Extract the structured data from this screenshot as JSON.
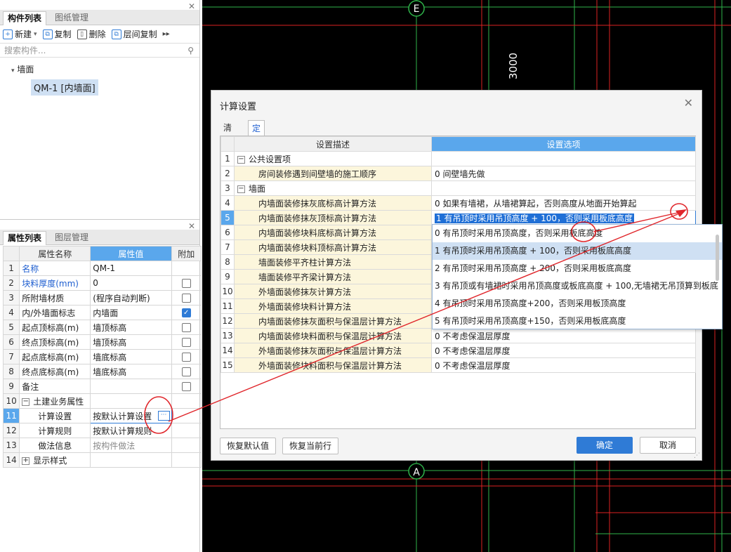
{
  "component_panel": {
    "tabs": [
      "构件列表",
      "图纸管理"
    ],
    "toolbar": {
      "new": "新建",
      "copy": "复制",
      "delete": "删除",
      "floor_copy": "层间复制"
    },
    "search_placeholder": "搜索构件...",
    "tree_group": "墙面",
    "tree_item": "QM-1 [内墙面]"
  },
  "property_panel": {
    "tabs": [
      "属性列表",
      "图层管理"
    ],
    "headers": {
      "name": "属性名称",
      "value": "属性值",
      "extra": "附加"
    },
    "rows": [
      {
        "n": "1",
        "name": "名称",
        "value": "QM-1",
        "checkbox": "none",
        "blue": true
      },
      {
        "n": "2",
        "name": "块料厚度(mm)",
        "value": "0",
        "checkbox": "off",
        "blue": true
      },
      {
        "n": "3",
        "name": "所附墙材质",
        "value": "(程序自动判断)",
        "checkbox": "off",
        "blue": false
      },
      {
        "n": "4",
        "name": "内/外墙面标志",
        "value": "内墙面",
        "checkbox": "on",
        "blue": false
      },
      {
        "n": "5",
        "name": "起点顶标高(m)",
        "value": "墙顶标高",
        "checkbox": "off",
        "blue": false
      },
      {
        "n": "6",
        "name": "终点顶标高(m)",
        "value": "墙顶标高",
        "checkbox": "off",
        "blue": false
      },
      {
        "n": "7",
        "name": "起点底标高(m)",
        "value": "墙底标高",
        "checkbox": "off",
        "blue": false
      },
      {
        "n": "8",
        "name": "终点底标高(m)",
        "value": "墙底标高",
        "checkbox": "off",
        "blue": false
      },
      {
        "n": "9",
        "name": "备注",
        "value": "",
        "checkbox": "off",
        "blue": false
      },
      {
        "n": "10",
        "name": "土建业务属性",
        "value": "",
        "checkbox": "none",
        "blue": false
      },
      {
        "n": "11",
        "name": "计算设置",
        "value": "按默认计算设置",
        "checkbox": "none",
        "blue": false
      },
      {
        "n": "12",
        "name": "计算规则",
        "value": "按默认计算规则",
        "checkbox": "none",
        "blue": false
      },
      {
        "n": "13",
        "name": "做法信息",
        "value": "按构件做法",
        "checkbox": "none",
        "blue": false
      },
      {
        "n": "14",
        "name": "显示样式",
        "value": "",
        "checkbox": "none",
        "blue": false
      }
    ],
    "ellipsis": "···"
  },
  "cad": {
    "axis_top": "E",
    "axis_bottom": "A",
    "dimension": "3000"
  },
  "dialog": {
    "title": "计算设置",
    "tabs": [
      "清单",
      "定额"
    ],
    "col_desc": "设置描述",
    "col_opt": "设置选项",
    "rows": [
      {
        "n": "1",
        "desc": "公共设置项",
        "opt": "",
        "group": true
      },
      {
        "n": "2",
        "desc": "房间装修遇到间壁墙的施工顺序",
        "opt": "0 间壁墙先做",
        "group": false
      },
      {
        "n": "3",
        "desc": "墙面",
        "opt": "",
        "group": true
      },
      {
        "n": "4",
        "desc": "内墙面装修抹灰底标高计算方法",
        "opt": "0 如果有墙裙，从墙裙算起，否则高度从地面开始算起",
        "group": false
      },
      {
        "n": "5",
        "desc": "内墙面装修抹灰顶标高计算方法",
        "opt": "1 有吊顶时采用吊顶高度 + 100，否则采用板底高度",
        "group": false
      },
      {
        "n": "6",
        "desc": "内墙面装修块料底标高计算方法",
        "opt": "",
        "group": false
      },
      {
        "n": "7",
        "desc": "内墙面装修块料顶标高计算方法",
        "opt": "",
        "group": false
      },
      {
        "n": "8",
        "desc": "墙面装修平齐柱计算方法",
        "opt": "",
        "group": false
      },
      {
        "n": "9",
        "desc": "墙面装修平齐梁计算方法",
        "opt": "",
        "group": false
      },
      {
        "n": "10",
        "desc": "外墙面装修抹灰计算方法",
        "opt": "",
        "group": false
      },
      {
        "n": "11",
        "desc": "外墙面装修块料计算方法",
        "opt": "",
        "group": false
      },
      {
        "n": "12",
        "desc": "内墙面装修抹灰面积与保温层计算方法",
        "opt": "",
        "group": false
      },
      {
        "n": "13",
        "desc": "内墙面装修块料面积与保温层计算方法",
        "opt": "0 不考虑保温层厚度",
        "group": false
      },
      {
        "n": "14",
        "desc": "外墙面装修抹灰面积与保温层计算方法",
        "opt": "0 不考虑保温层厚度",
        "group": false
      },
      {
        "n": "15",
        "desc": "外墙面装修块料面积与保温层计算方法",
        "opt": "0 不考虑保温层厚度",
        "group": false
      }
    ],
    "dropdown": [
      "0 有吊顶时采用吊顶高度，否则采用板底高度",
      "1 有吊顶时采用吊顶高度 + 100，否则采用板底高度",
      "2 有吊顶时采用吊顶高度 + 200，否则采用板底高度",
      "3 有吊顶或有墙裙时采用吊顶高度或板底高度 + 100,无墙裙无吊顶算到板底",
      "4 有吊顶时采用吊顶高度+200，否则采用板顶高度",
      "5 有吊顶时采用吊顶高度+150，否则采用板底高度"
    ],
    "buttons": {
      "restore_default": "恢复默认值",
      "restore_row": "恢复当前行",
      "ok": "确定",
      "cancel": "取消"
    }
  },
  "colors": {
    "accent": "#2f7bd6",
    "header_selected": "#5aa7ec",
    "annotation": "#e0262b"
  }
}
